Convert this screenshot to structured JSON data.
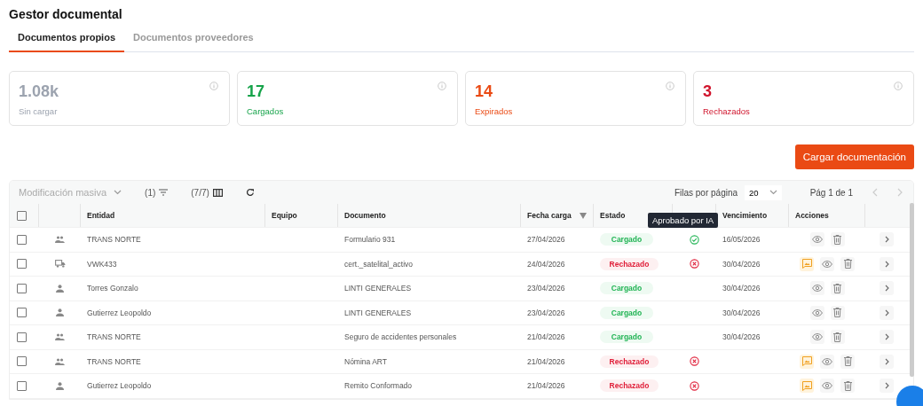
{
  "title": "Gestor documental",
  "tabs": [
    {
      "label": "Documentos propios",
      "selected": true
    },
    {
      "label": "Documentos proveedores",
      "selected": false
    }
  ],
  "stats": [
    {
      "value": "1.08k",
      "label": "Sin cargar",
      "color": "#9ca3af"
    },
    {
      "value": "17",
      "label": "Cargados",
      "color": "#16a34a"
    },
    {
      "value": "14",
      "label": "Expirados",
      "color": "#ea4a14"
    },
    {
      "value": "3",
      "label": "Rechazados",
      "color": "#d0142c"
    }
  ],
  "upload_button": "Cargar documentación",
  "toolbar": {
    "bulk_edit": "Modificación masiva",
    "filters": "(1)",
    "columns": "(7/7)",
    "rows_per_page_label": "Filas por página",
    "rows_per_page": "20",
    "page": "Pág 1 de 1"
  },
  "select_all": {
    "checked": false
  },
  "columns": [
    "Entidad",
    "Equipo",
    "Documento",
    "Fecha carga",
    "Estado",
    "Vencimiento",
    "Acciones"
  ],
  "tooltip": "Aprobado por IA",
  "rows": [
    {
      "kind": "group",
      "entity": "TRANS NORTE",
      "document": "Formulario 931",
      "uploaded": "27/04/2026",
      "status": "Cargado",
      "rejected": false,
      "ai_reviewed": true,
      "ai_approved": true,
      "expires": "16/05/2026",
      "image_action": false,
      "checked": false
    },
    {
      "kind": "truck",
      "entity": "VWK433",
      "document": "cert._satelital_activo",
      "uploaded": "24/04/2026",
      "status": "Rechazado",
      "rejected": true,
      "ai_reviewed": true,
      "ai_approved": false,
      "expires": "30/04/2026",
      "image_action": true,
      "checked": false
    },
    {
      "kind": "person",
      "entity": "Torres Gonzalo",
      "document": "LINTI GENERALES",
      "uploaded": "23/04/2026",
      "status": "Cargado",
      "rejected": false,
      "ai_reviewed": false,
      "expires": "30/04/2026",
      "image_action": false,
      "checked": false
    },
    {
      "kind": "person",
      "entity": "Gutierrez Leopoldo",
      "document": "LINTI GENERALES",
      "uploaded": "23/04/2026",
      "status": "Cargado",
      "rejected": false,
      "ai_reviewed": false,
      "expires": "30/04/2026",
      "image_action": false,
      "checked": false
    },
    {
      "kind": "group",
      "entity": "TRANS NORTE",
      "document": "Seguro de accidentes personales",
      "uploaded": "21/04/2026",
      "status": "Cargado",
      "rejected": false,
      "ai_reviewed": false,
      "expires": "30/04/2026",
      "image_action": false,
      "checked": false
    },
    {
      "kind": "group",
      "entity": "TRANS NORTE",
      "document": "Nómina ART",
      "uploaded": "21/04/2026",
      "status": "Rechazado",
      "rejected": true,
      "ai_reviewed": true,
      "ai_approved": false,
      "image_action": true,
      "checked": false
    },
    {
      "kind": "person",
      "entity": "Gutierrez Leopoldo",
      "document": "Remito Conformado",
      "uploaded": "21/04/2026",
      "status": "Rechazado",
      "rejected": true,
      "ai_reviewed": true,
      "ai_approved": false,
      "image_action": true,
      "checked": false
    }
  ]
}
